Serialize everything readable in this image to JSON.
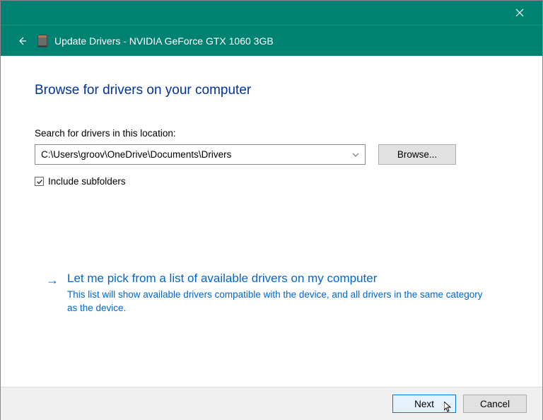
{
  "titlebar": {
    "close_tooltip": "Close"
  },
  "header": {
    "title": "Update Drivers - NVIDIA GeForce GTX 1060 3GB"
  },
  "main": {
    "heading": "Browse for drivers on your computer",
    "search_label": "Search for drivers in this location:",
    "path_value": "C:\\Users\\groov\\OneDrive\\Documents\\Drivers",
    "browse_label": "Browse...",
    "include_subfolders_label": "Include subfolders",
    "include_subfolders_checked": true
  },
  "option": {
    "title": "Let me pick from a list of available drivers on my computer",
    "description": "This list will show available drivers compatible with the device, and all drivers in the same category as the device."
  },
  "footer": {
    "next_label": "Next",
    "cancel_label": "Cancel"
  }
}
